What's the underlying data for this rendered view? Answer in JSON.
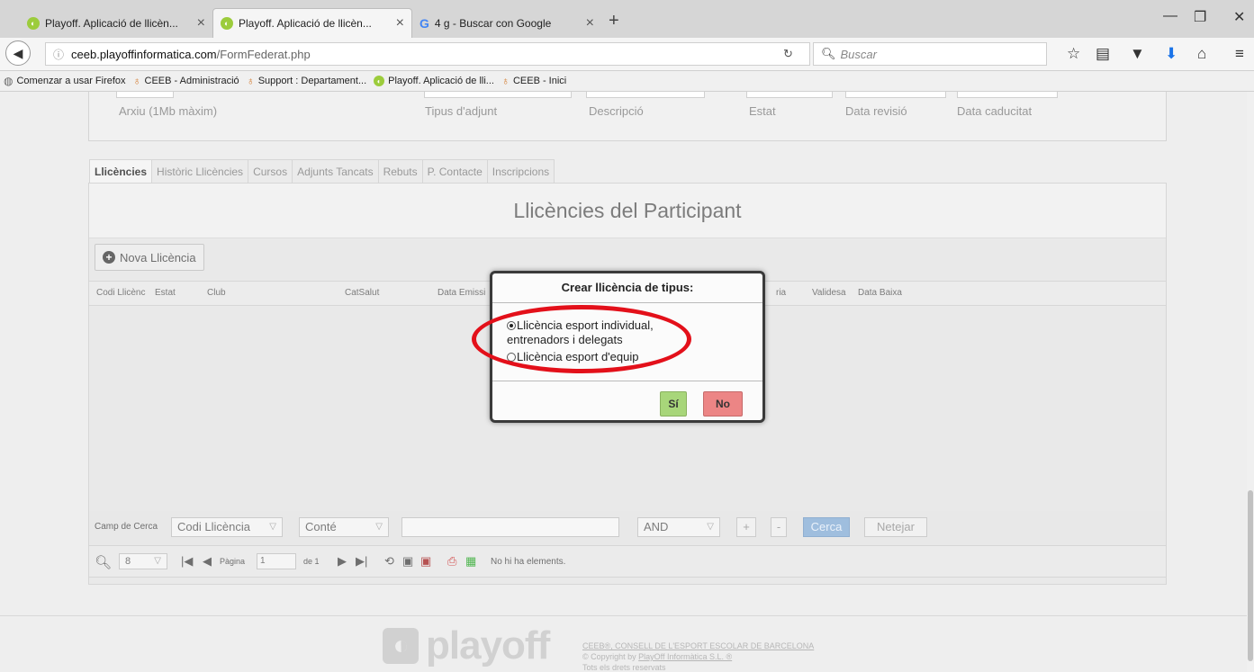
{
  "browser": {
    "tabs": [
      {
        "title": "Playoff. Aplicació de llicèn...",
        "favicon": "playoff-icon"
      },
      {
        "title": "Playoff. Aplicació de llicèn...",
        "favicon": "playoff-icon"
      },
      {
        "title": "4 g - Buscar con Google",
        "favicon": "google-icon"
      }
    ],
    "url_host": "ceeb.playoffinformatica.com",
    "url_path": "/FormFederat.php",
    "search_placeholder": "Buscar",
    "bookmarks": [
      "Comenzar a usar Firefox",
      "CEEB - Administració",
      "Support : Departament...",
      "Playoff. Aplicació de lli...",
      "CEEB - Inici"
    ]
  },
  "upper_form": {
    "labels": [
      "Arxiu (1Mb màxim)",
      "Tipus d'adjunt",
      "Descripció",
      "Estat",
      "Data revisió",
      "Data caducitat"
    ]
  },
  "tabs": [
    "Llicències",
    "Històric Llicències",
    "Cursos",
    "Adjunts Tancats",
    "Rebuts",
    "P. Contacte",
    "Inscripcions"
  ],
  "panel": {
    "title": "Llicències del Participant",
    "new_button": "Nova Llicència",
    "columns": [
      "Codi Llicènc",
      "Estat",
      "Club",
      "CatSalut",
      "Data Emissi",
      "ria",
      "Validesa",
      "Data Baixa"
    ]
  },
  "search": {
    "label": "Camp de Cerca",
    "field": "Codi Llicència",
    "operator": "Conté",
    "logic": "AND",
    "plus": "+",
    "minus": "-",
    "search_btn": "Cerca",
    "clear_btn": "Netejar"
  },
  "pager": {
    "page_size": "8",
    "page_label": "Pàgina",
    "page_value": "1",
    "of_label": "de 1",
    "status": "No hi ha elements."
  },
  "footer": {
    "logo": "playoff",
    "line1": "CEEB®, CONSELL DE L'ESPORT ESCOLAR DE BARCELONA",
    "line2_prefix": "© Copyright by",
    "line2_link": "PlayOff Informàtica S.L. ®",
    "line3": "Tots els drets reservats"
  },
  "dialog": {
    "title": "Crear llicència de tipus:",
    "option1_line1": "Llicència esport individual,",
    "option1_line2": "entrenadors i delegats",
    "option2": "Llicència esport d'equip",
    "yes": "Sí",
    "no": "No"
  },
  "colors": {
    "highlight": "#e3101a",
    "yes_button": "#a8d67a",
    "no_button": "#ec8585"
  }
}
